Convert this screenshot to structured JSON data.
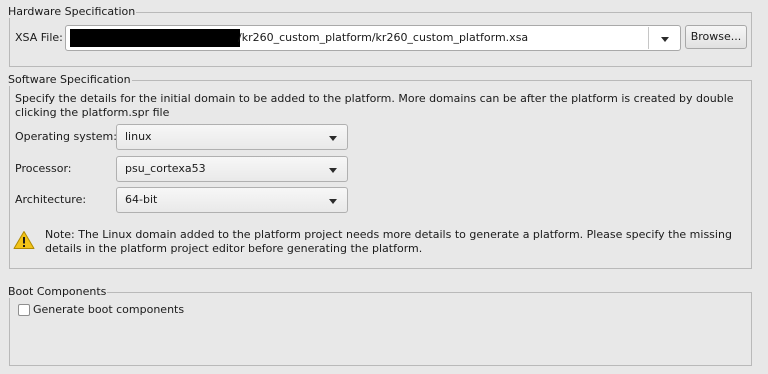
{
  "hardware": {
    "title": "Hardware Specification",
    "xsa_label": "XSA File:",
    "xsa_value": "/kr260_custom_platform/kr260_custom_platform.xsa",
    "browse_label": "Browse..."
  },
  "software": {
    "title": "Software Specification",
    "description_line1": "Specify the details for the initial domain to be added to the platform. More domains can be after the platform is created by double",
    "description_line2": "clicking the platform.spr file",
    "os_label": "Operating system:",
    "os_value": "linux",
    "processor_label": "Processor:",
    "processor_value": "psu_cortexa53",
    "arch_label": "Architecture:",
    "arch_value": "64-bit",
    "note_line1": "Note: The Linux domain added to the platform project needs more details to generate a platform. Please specify the missing",
    "note_line2": "details in the platform project editor before generating the platform."
  },
  "boot": {
    "title": "Boot Components",
    "generate_label": "Generate boot components",
    "generate_checked": false
  },
  "colors": {
    "background": "#e8e8e8",
    "warning": "#f2c318"
  },
  "icons": {
    "warning": "warning-icon",
    "dropdown": "chevron-down-icon"
  }
}
